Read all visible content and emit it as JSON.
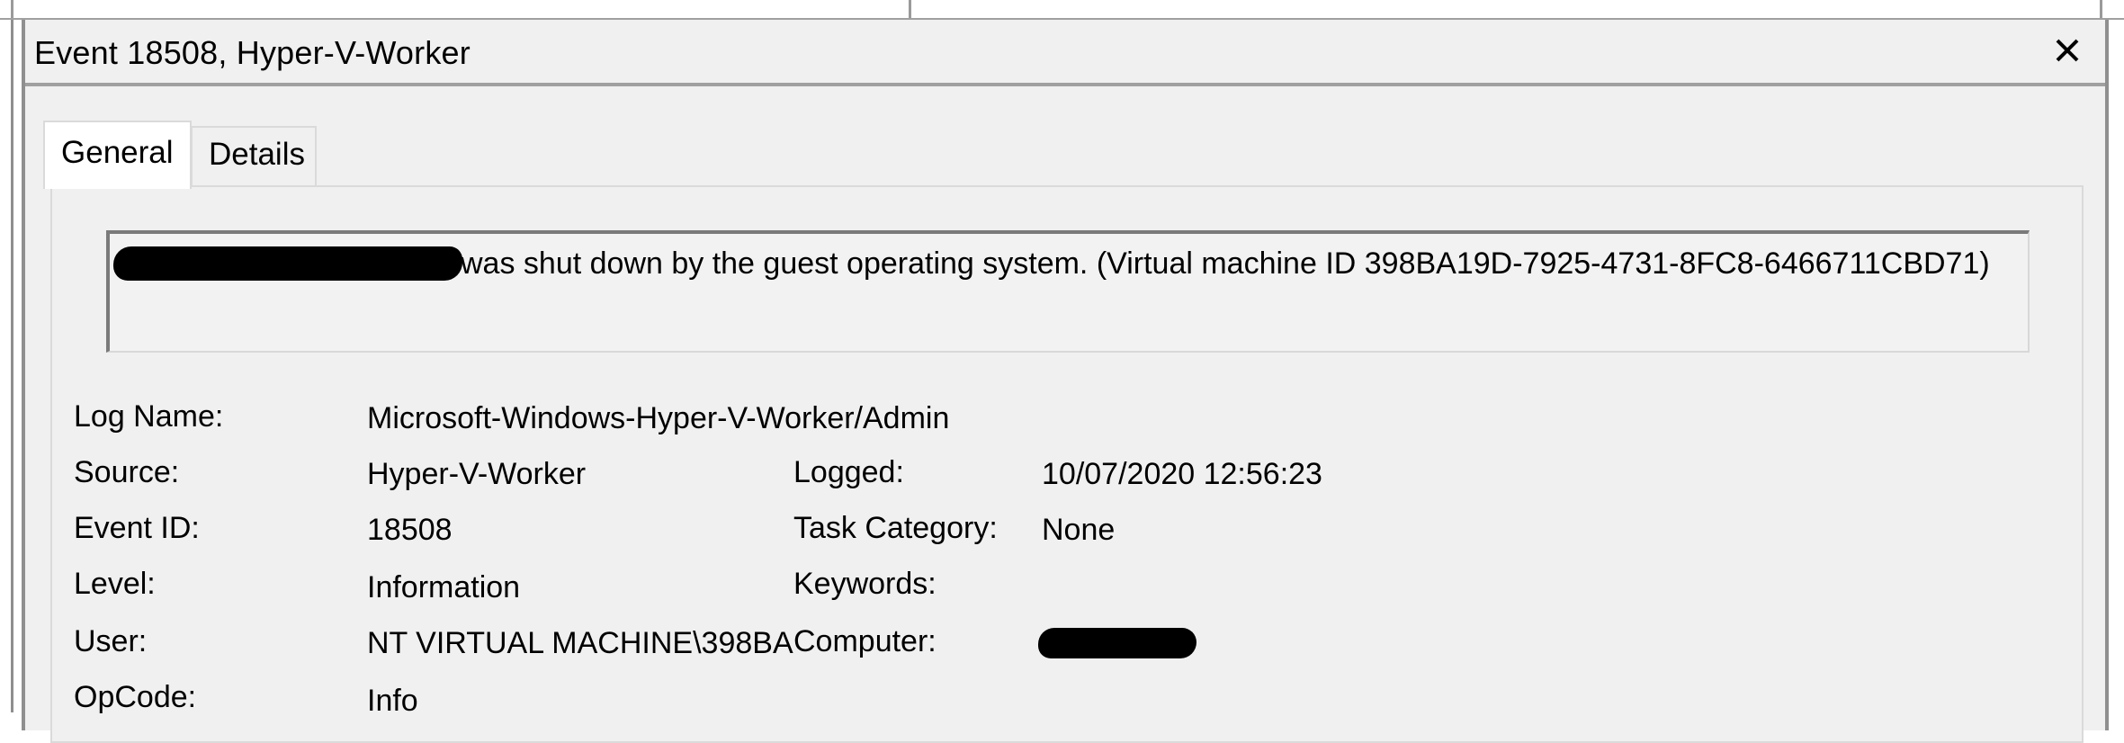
{
  "window": {
    "title": "Event 18508, Hyper-V-Worker",
    "close_icon": "close-icon"
  },
  "tabs": [
    {
      "label": "General",
      "active": true
    },
    {
      "label": "Details",
      "active": false
    }
  ],
  "general": {
    "description": "was shut down by the guest operating system. (Virtual machine ID 398BA19D-7925-4731-8FC8-6466711CBD71)",
    "fields": {
      "log_name": {
        "label": "Log Name:",
        "value": "Microsoft-Windows-Hyper-V-Worker/Admin"
      },
      "source": {
        "label": "Source:",
        "value": "Hyper-V-Worker"
      },
      "logged": {
        "label": "Logged:",
        "value": "10/07/2020 12:56:23"
      },
      "event_id": {
        "label": "Event ID:",
        "value": "18508"
      },
      "task_category": {
        "label": "Task Category:",
        "value": "None"
      },
      "level": {
        "label": "Level:",
        "value": "Information"
      },
      "keywords": {
        "label": "Keywords:",
        "value": ""
      },
      "user": {
        "label": "User:",
        "value": "NT VIRTUAL MACHINE\\398BA"
      },
      "computer": {
        "label": "Computer:",
        "value": ""
      },
      "opcode": {
        "label": "OpCode:",
        "value": "Info"
      }
    }
  }
}
